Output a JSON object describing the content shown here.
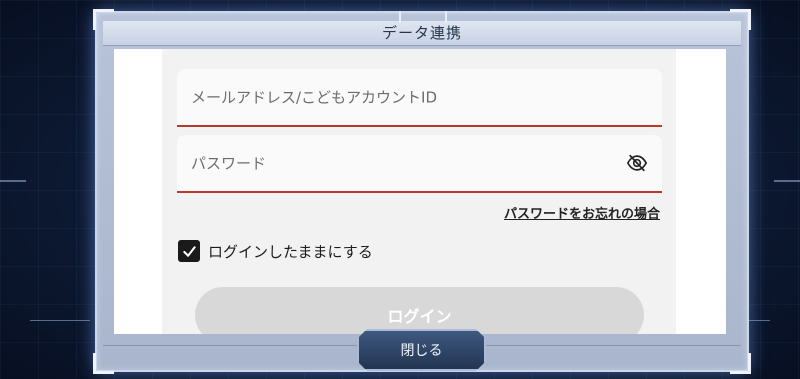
{
  "dialog": {
    "title": "データ連携"
  },
  "form": {
    "email_placeholder": "メールアドレス/こどもアカウントID",
    "password_placeholder": "パスワード",
    "forgot_password": "パスワードをお忘れの場合",
    "keep_logged_in": "ログインしたままにする",
    "keep_logged_in_checked": true,
    "login_button": "ログイン"
  },
  "footer": {
    "close_button": "閉じる"
  },
  "icons": {
    "password_toggle": "eye-off-icon",
    "checkbox": "check-icon"
  },
  "colors": {
    "field_underline": "#b83a2e",
    "checkbox": "#1a1a1a",
    "login_disabled": "#d8d8d8"
  }
}
